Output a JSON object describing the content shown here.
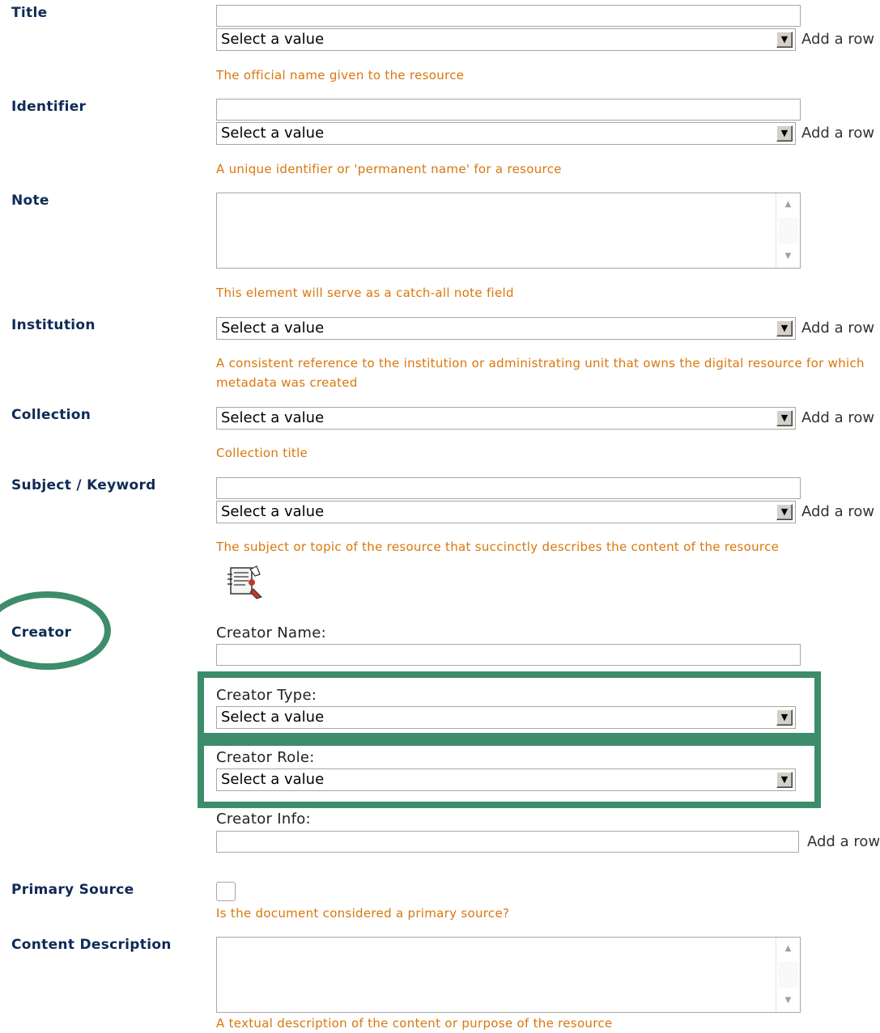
{
  "fields": {
    "title": {
      "label": "Title",
      "select_value": "Select a value",
      "add_row": "Add a row",
      "help": "The official name given to the resource"
    },
    "identifier": {
      "label": "Identifier",
      "select_value": "Select a value",
      "add_row": "Add a row",
      "help": "A unique identifier or 'permanent name' for a resource"
    },
    "note": {
      "label": "Note",
      "help": "This element will serve as a catch-all note field"
    },
    "institution": {
      "label": "Institution",
      "select_value": "Select a value",
      "add_row": "Add a row",
      "help": "A consistent reference to the institution or administrating unit that owns the digital resource for which metadata was created"
    },
    "collection": {
      "label": "Collection",
      "select_value": "Select a value",
      "add_row": "Add a row",
      "help": "Collection title"
    },
    "subject": {
      "label": "Subject / Keyword",
      "select_value": "Select a value",
      "add_row": "Add a row",
      "help": "The subject or topic of the resource that succinctly describes the content of the resource",
      "thesaurus_icon": "thesaurus-lookup-icon"
    },
    "creator": {
      "label": "Creator",
      "name_caption": "Creator Name:",
      "type_caption": "Creator Type:",
      "type_select_value": "Select a value",
      "role_caption": "Creator Role:",
      "role_select_value": "Select a value",
      "info_caption": "Creator Info:",
      "add_row": "Add a row"
    },
    "primary_source": {
      "label": "Primary Source",
      "checked": false,
      "help": "Is the document considered a primary source?"
    },
    "content_description": {
      "label": "Content Description",
      "help": "A textual description of the content or purpose of the resource"
    }
  },
  "colors": {
    "label": "#0f2a55",
    "help_text": "#d9770d",
    "annotation": "#3d8c6b"
  }
}
